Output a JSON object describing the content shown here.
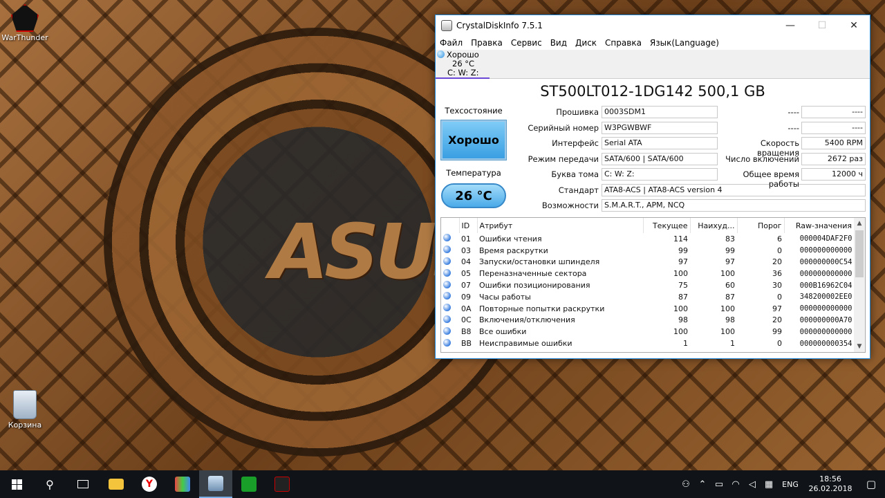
{
  "desktop": {
    "icons": [
      {
        "label": "WarThunder"
      },
      {
        "label": "Корзина"
      }
    ],
    "wallpaper_text": "ASUS"
  },
  "window": {
    "title": "CrystalDiskInfo 7.5.1",
    "controls": {
      "minimize": "—",
      "maximize": "☐",
      "close": "✕"
    },
    "menu": [
      "Файл",
      "Правка",
      "Сервис",
      "Вид",
      "Диск",
      "Справка",
      "Язык(Language)"
    ],
    "disk_tab": {
      "status": "Хорошо",
      "temp": "26 °C",
      "volumes": "C: W: Z:"
    },
    "model": "ST500LT012-1DG142 500,1 GB",
    "health": {
      "label": "Техсостояние",
      "value": "Хорошо"
    },
    "temperature": {
      "label": "Температура",
      "value": "26 °C"
    },
    "info": {
      "firmware": {
        "label": "Прошивка",
        "value": "0003SDM1"
      },
      "serial": {
        "label": "Серийный номер",
        "value": "W3PGWBWF"
      },
      "interface": {
        "label": "Интерфейс",
        "value": "Serial ATA"
      },
      "transfer": {
        "label": "Режим передачи",
        "value": "SATA/600 | SATA/600"
      },
      "drive_letter": {
        "label": "Буква тома",
        "value": "C: W: Z:"
      },
      "standard": {
        "label": "Стандарт",
        "value": "ATA8-ACS | ATA8-ACS version 4"
      },
      "features": {
        "label": "Возможности",
        "value": "S.M.A.R.T., APM, NCQ"
      },
      "blank1": {
        "label": "----",
        "value": "----"
      },
      "blank2": {
        "label": "----",
        "value": "----"
      },
      "rotation": {
        "label": "Скорость вращения",
        "value": "5400 RPM"
      },
      "power_count": {
        "label": "Число включений",
        "value": "2672 раз"
      },
      "power_hours": {
        "label": "Общее время работы",
        "value": "12000 ч"
      }
    },
    "smart": {
      "headers": [
        "ID",
        "Атрибут",
        "Текущее",
        "Наихуд...",
        "Порог",
        "Raw-значения"
      ],
      "rows": [
        {
          "id": "01",
          "attr": "Ошибки чтения",
          "cur": "114",
          "worst": "83",
          "thr": "6",
          "raw": "000004DAF2F0"
        },
        {
          "id": "03",
          "attr": "Время раскрутки",
          "cur": "99",
          "worst": "99",
          "thr": "0",
          "raw": "000000000000"
        },
        {
          "id": "04",
          "attr": "Запуски/остановки шпинделя",
          "cur": "97",
          "worst": "97",
          "thr": "20",
          "raw": "000000000C54"
        },
        {
          "id": "05",
          "attr": "Переназначенные сектора",
          "cur": "100",
          "worst": "100",
          "thr": "36",
          "raw": "000000000000"
        },
        {
          "id": "07",
          "attr": "Ошибки позиционирования",
          "cur": "75",
          "worst": "60",
          "thr": "30",
          "raw": "000B16962C04"
        },
        {
          "id": "09",
          "attr": "Часы работы",
          "cur": "87",
          "worst": "87",
          "thr": "0",
          "raw": "348200002EE0"
        },
        {
          "id": "0A",
          "attr": "Повторные попытки раскрутки",
          "cur": "100",
          "worst": "100",
          "thr": "97",
          "raw": "000000000000"
        },
        {
          "id": "0C",
          "attr": "Включения/отключения",
          "cur": "98",
          "worst": "98",
          "thr": "20",
          "raw": "000000000A70"
        },
        {
          "id": "B8",
          "attr": "Все ошибки",
          "cur": "100",
          "worst": "100",
          "thr": "99",
          "raw": "000000000000"
        },
        {
          "id": "BB",
          "attr": "Неисправимые ошибки",
          "cur": "1",
          "worst": "1",
          "thr": "0",
          "raw": "000000000354"
        }
      ]
    }
  },
  "taskbar": {
    "language": "ENG",
    "time": "18:56",
    "date": "26.02.2018"
  },
  "colors": {
    "accent": "#1883d7",
    "good": "#3a9fe2",
    "taskbar": "#101418"
  }
}
